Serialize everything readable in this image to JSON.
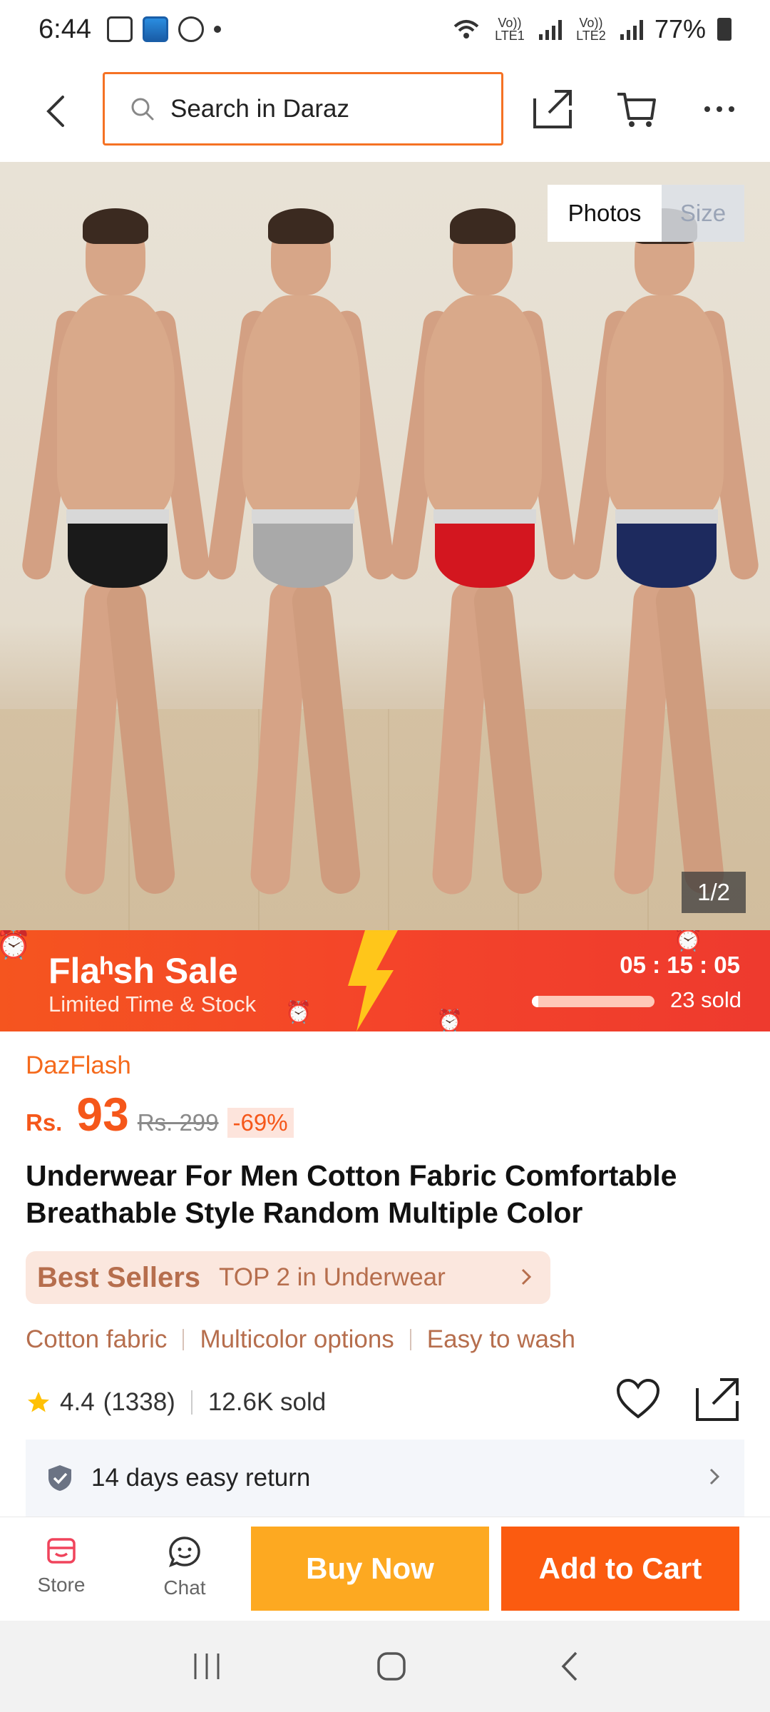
{
  "status_bar": {
    "time": "6:44",
    "lte1": "Vo)) LTE1",
    "lte2": "Vo)) LTE2",
    "battery": "77%"
  },
  "header": {
    "search_placeholder": "Search in Daraz",
    "icons": [
      "back-icon",
      "share-icon",
      "cart-icon",
      "more-icon"
    ]
  },
  "gallery": {
    "tabs": [
      {
        "label": "Photos",
        "active": true
      },
      {
        "label": "Size",
        "active": false
      }
    ],
    "counter": "1/2",
    "models": [
      {
        "brief_color": "#1a1a1a"
      },
      {
        "brief_color": "#a9a9a9"
      },
      {
        "brief_color": "#d3161f"
      },
      {
        "brief_color": "#1d2a5e"
      }
    ]
  },
  "flash_sale": {
    "title": "Flaʰsh  Sale",
    "subtitle": "Limited Time & Stock",
    "timer": "05 : 15 : 05",
    "sold": "23 sold",
    "progress": 0.05
  },
  "product": {
    "promo_tag": "DazFlash",
    "currency": "Rs.",
    "price": "93",
    "old_price": "Rs. 299",
    "discount": "-69%",
    "title": "Underwear For Men Cotton Fabric Comfortable Breathable Style Random Multiple Color",
    "best_sellers": {
      "label": "Best Sellers",
      "rank": "TOP 2 in Underwear"
    },
    "features": [
      "Cotton fabric",
      "Multicolor options",
      "Easy to wash"
    ],
    "rating": "4.4",
    "rating_count": "(1338)",
    "sold": "12.6K sold",
    "return_policy": "14 days easy return"
  },
  "action_bar": {
    "store": "Store",
    "chat": "Chat",
    "buy_now": "Buy Now",
    "add_to_cart": "Add to Cart"
  },
  "colors": {
    "accent": "#f57224",
    "buy": "#fda921",
    "cart": "#fb5b10"
  }
}
